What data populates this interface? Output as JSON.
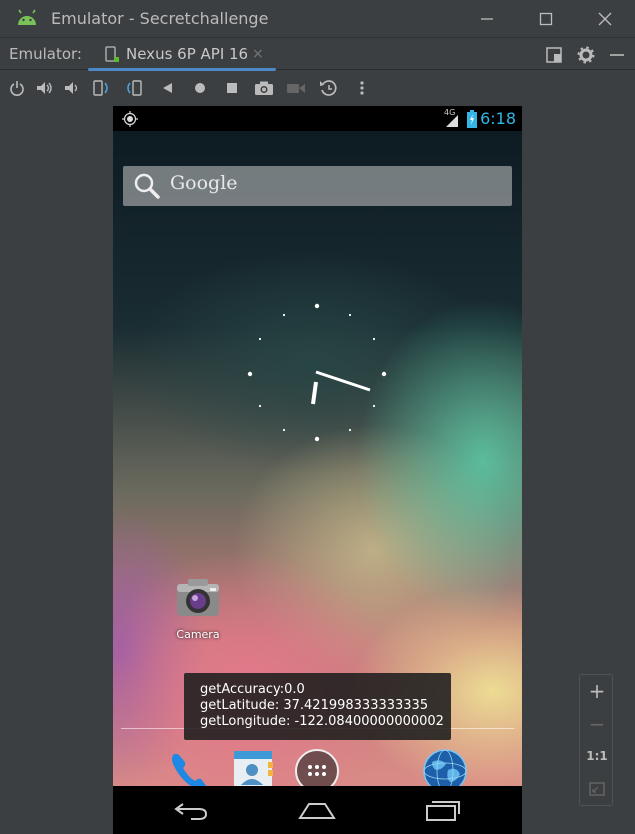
{
  "window": {
    "title": "Emulator - Secretchallenge",
    "controls": {
      "minimize": "–",
      "maximize": "☐",
      "close": "✕"
    }
  },
  "tabbar": {
    "label": "Emulator:",
    "tab": {
      "label": "Nexus 6P API 16",
      "close": "×"
    },
    "right_icons": [
      "layout-icon",
      "gear-icon",
      "minimize-panel-icon"
    ]
  },
  "toolbar": {
    "buttons": [
      "power-icon",
      "volume-up-icon",
      "volume-down-icon",
      "rotate-left-icon",
      "rotate-right-icon",
      "back-triangle-icon",
      "home-circle-icon",
      "overview-square-icon",
      "camera-icon",
      "record-icon",
      "snapshot-icon",
      "more-icon"
    ]
  },
  "phone": {
    "statusbar": {
      "signal": "4G",
      "clock": "6:18"
    },
    "search": {
      "text": "Google"
    },
    "app": {
      "label": "Camera"
    },
    "toast": {
      "line1": "getAccuracy:0.0",
      "line2": "getLatitude: 37.421998333333335",
      "line3": "getLongitude: -122.08400000000002"
    },
    "dock": [
      "phone-icon",
      "contacts-icon",
      "all-apps-icon",
      "browser-globe-icon"
    ],
    "navbar": [
      "back-icon",
      "home-icon",
      "recents-icon"
    ]
  },
  "zoom": {
    "in": "+",
    "out": "−",
    "one_to_one": "1:1"
  },
  "colors": {
    "accent": "#4a88c7",
    "clock": "#33b5e5",
    "chrome": "#3c3f41"
  }
}
